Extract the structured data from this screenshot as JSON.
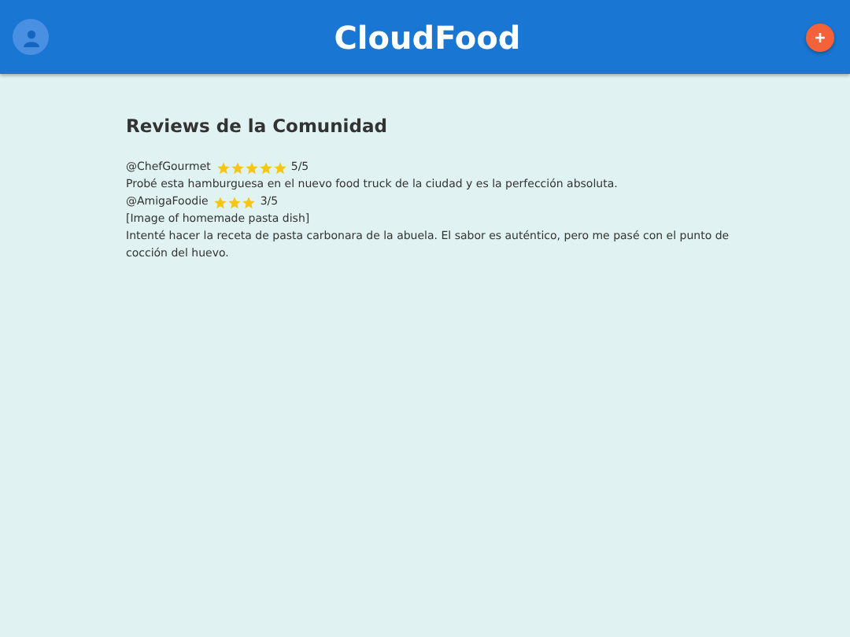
{
  "header": {
    "title": "CloudFood"
  },
  "reviews_section": {
    "title": "Reviews de la Comunidad",
    "reviews": [
      {
        "user": "@ChefGourmet",
        "stars": 5,
        "score": "5/5",
        "text": "Probé esta hamburguesa en el nuevo food truck de la ciudad y es la perfección absoluta."
      },
      {
        "user": "@AmigaFoodie",
        "stars": 3,
        "score": "3/5",
        "image_note": "[Image of homemade pasta dish]",
        "text": "Intenté hacer la receta de pasta carbonara de la abuela. El sabor es auténtico, pero me pasé con el punto de cocción del huevo."
      }
    ]
  }
}
